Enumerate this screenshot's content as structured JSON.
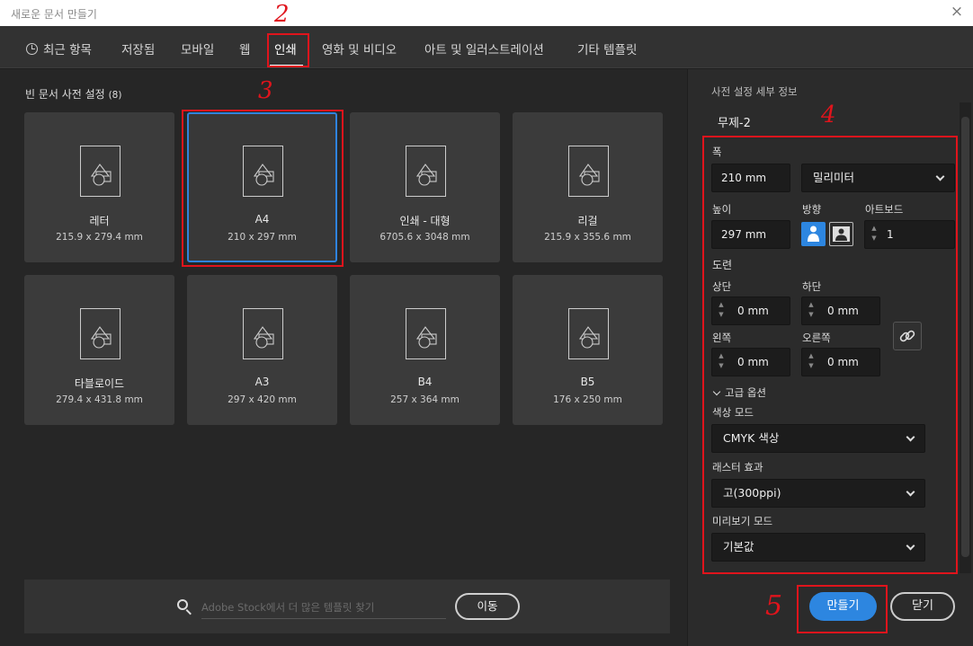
{
  "window": {
    "title": "새로운 문서 만들기",
    "close": "×"
  },
  "tabs": [
    "최근 항목",
    "저장됨",
    "모바일",
    "웹",
    "인쇄",
    "영화 및 비디오",
    "아트 및 일러스트레이션",
    "기타 템플릿"
  ],
  "active_tab": "인쇄",
  "annotations": [
    "2",
    "3",
    "4",
    "5"
  ],
  "presets": {
    "title": "빈 문서 사전 설정",
    "count": "(8)",
    "cards": [
      {
        "name": "레터",
        "size": "215.9 x 279.4 mm"
      },
      {
        "name": "A4",
        "size": "210 x 297 mm"
      },
      {
        "name": "인쇄 - 대형",
        "size": "6705.6 x 3048 mm"
      },
      {
        "name": "리걸",
        "size": "215.9 x 355.6 mm"
      },
      {
        "name": "타블로이드",
        "size": "279.4 x 431.8 mm"
      },
      {
        "name": "A3",
        "size": "297 x 420 mm"
      },
      {
        "name": "B4",
        "size": "257 x 364 mm"
      },
      {
        "name": "B5",
        "size": "176 x 250 mm"
      }
    ],
    "selected": "A4"
  },
  "search": {
    "placeholder": "Adobe Stock에서 더 많은 템플릿 찾기",
    "button": "이동"
  },
  "details": {
    "header": "사전 설정 세부 정보",
    "doc_name": "무제-2",
    "width_label": "폭",
    "width_value": "210 mm",
    "unit_value": "밀리미터",
    "height_label": "높이",
    "height_value": "297 mm",
    "orientation_label": "방향",
    "artboard_label": "아트보드",
    "artboard_value": "1",
    "bleed_label": "도련",
    "top_label": "상단",
    "top_value": "0 mm",
    "bottom_label": "하단",
    "bottom_value": "0 mm",
    "left_label": "왼쪽",
    "left_value": "0 mm",
    "right_label": "오른쪽",
    "right_value": "0 mm",
    "advanced_label": "고급 옵션",
    "color_mode_label": "색상 모드",
    "color_mode_value": "CMYK 색상",
    "raster_label": "래스터 효과",
    "raster_value": "고(300ppi)",
    "preview_label": "미리보기 모드",
    "preview_value": "기본값"
  },
  "buttons": {
    "create": "만들기",
    "close": "닫기"
  },
  "colors": {
    "accent": "#2d86e0",
    "annotation": "#e0141c"
  }
}
